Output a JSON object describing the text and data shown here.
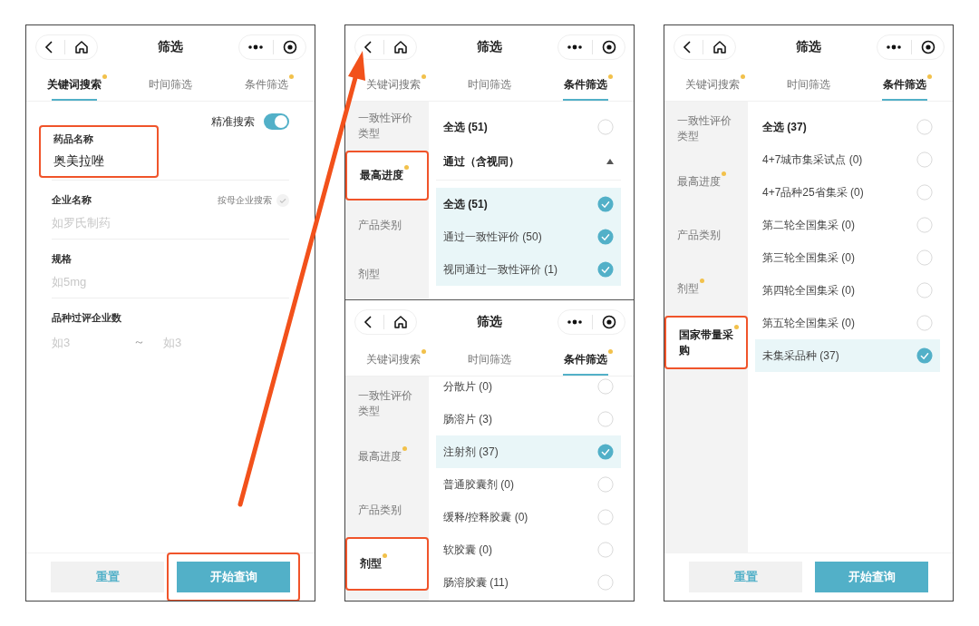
{
  "panels": [
    {
      "screens": [
        {
          "kind": "keyword",
          "title": "筛选",
          "tabs": [
            {
              "label": "关键词搜索",
              "selected": true,
              "dot": true
            },
            {
              "label": "时间筛选",
              "selected": false,
              "dot": false
            },
            {
              "label": "条件筛选",
              "selected": false,
              "dot": true
            }
          ],
          "precise_search": {
            "label": "精准搜索",
            "on": true
          },
          "fields": [
            {
              "label": "药品名称",
              "value": "奥美拉唑",
              "highlighted": true
            },
            {
              "label": "企业名称",
              "placeholder": "如罗氏制药",
              "option": {
                "label": "按母企业搜索",
                "checked": false
              }
            },
            {
              "label": "规格",
              "placeholder": "如5mg"
            }
          ],
          "range_field": {
            "label": "品种过评企业数",
            "min_placeholder": "如3",
            "separator": "～",
            "max_placeholder": "如3"
          },
          "buttons": [
            {
              "label": "重置",
              "kind": "secondary",
              "highlighted": false
            },
            {
              "label": "开始查询",
              "kind": "primary",
              "highlighted": true
            }
          ]
        }
      ]
    },
    {
      "screens": [
        {
          "kind": "condition",
          "title": "筛选",
          "tabs": [
            {
              "label": "关键词搜索",
              "selected": false,
              "dot": true
            },
            {
              "label": "时间筛选",
              "selected": false,
              "dot": false
            },
            {
              "label": "条件筛选",
              "selected": true,
              "dot": true
            }
          ],
          "sidebar": [
            {
              "label": "一致性评价类型",
              "selected": false,
              "dot": false,
              "highlighted": false
            },
            {
              "label": "最高进度",
              "selected": true,
              "dot": true,
              "highlighted": true
            },
            {
              "label": "产品类别",
              "selected": false,
              "dot": false,
              "highlighted": false
            },
            {
              "label": "剂型",
              "selected": false,
              "dot": false,
              "highlighted": false
            }
          ],
          "options": [
            {
              "kind": "select_all",
              "label": "全选 (51)",
              "checked": false
            },
            {
              "kind": "group",
              "label": "通过（含视同）",
              "expanded": true,
              "children": [
                {
                  "kind": "select_all",
                  "label": "全选 (51)",
                  "checked": true
                },
                {
                  "kind": "option",
                  "label": "通过一致性评价 (50)",
                  "checked": true
                },
                {
                  "kind": "option",
                  "label": "视同通过一致性评价 (1)",
                  "checked": true
                }
              ]
            }
          ]
        },
        {
          "kind": "condition",
          "title": "筛选",
          "tabs": [
            {
              "label": "关键词搜索",
              "selected": false,
              "dot": true
            },
            {
              "label": "时间筛选",
              "selected": false,
              "dot": false
            },
            {
              "label": "条件筛选",
              "selected": true,
              "dot": true
            }
          ],
          "sidebar": [
            {
              "label": "一致性评价类型",
              "selected": false,
              "dot": false,
              "highlighted": false
            },
            {
              "label": "最高进度",
              "selected": false,
              "dot": true,
              "highlighted": false
            },
            {
              "label": "产品类别",
              "selected": false,
              "dot": false,
              "highlighted": false
            },
            {
              "label": "剂型",
              "selected": true,
              "dot": true,
              "highlighted": true
            }
          ],
          "options": [
            {
              "kind": "option",
              "label": "分散片 (0)",
              "checked": false
            },
            {
              "kind": "option",
              "label": "肠溶片 (3)",
              "checked": false
            },
            {
              "kind": "option",
              "label": "注射剂 (37)",
              "checked": true
            },
            {
              "kind": "option",
              "label": "普通胶囊剂 (0)",
              "checked": false
            },
            {
              "kind": "option",
              "label": "缓释/控释胶囊 (0)",
              "checked": false
            },
            {
              "kind": "option",
              "label": "软胶囊 (0)",
              "checked": false
            },
            {
              "kind": "option",
              "label": "肠溶胶囊 (11)",
              "checked": false
            }
          ]
        }
      ]
    },
    {
      "screens": [
        {
          "kind": "condition",
          "title": "筛选",
          "tabs": [
            {
              "label": "关键词搜索",
              "selected": false,
              "dot": true
            },
            {
              "label": "时间筛选",
              "selected": false,
              "dot": false
            },
            {
              "label": "条件筛选",
              "selected": true,
              "dot": true
            }
          ],
          "sidebar": [
            {
              "label": "一致性评价类型",
              "selected": false,
              "dot": false,
              "highlighted": false
            },
            {
              "label": "最高进度",
              "selected": false,
              "dot": true,
              "highlighted": false
            },
            {
              "label": "产品类别",
              "selected": false,
              "dot": false,
              "highlighted": false
            },
            {
              "label": "剂型",
              "selected": false,
              "dot": true,
              "highlighted": false
            },
            {
              "label": "国家带量采购",
              "selected": true,
              "dot": true,
              "highlighted": true
            }
          ],
          "options": [
            {
              "kind": "select_all",
              "label": "全选 (37)",
              "checked": false
            },
            {
              "kind": "option",
              "label": "4+7城市集采试点 (0)",
              "checked": false
            },
            {
              "kind": "option",
              "label": "4+7品种25省集采 (0)",
              "checked": false
            },
            {
              "kind": "option",
              "label": "第二轮全国集采 (0)",
              "checked": false
            },
            {
              "kind": "option",
              "label": "第三轮全国集采 (0)",
              "checked": false
            },
            {
              "kind": "option",
              "label": "第四轮全国集采 (0)",
              "checked": false
            },
            {
              "kind": "option",
              "label": "第五轮全国集采 (0)",
              "checked": false
            },
            {
              "kind": "option",
              "label": "未集采品种 (37)",
              "checked": true
            }
          ],
          "buttons": [
            {
              "label": "重置",
              "kind": "secondary",
              "highlighted": false
            },
            {
              "label": "开始查询",
              "kind": "primary",
              "highlighted": false
            }
          ]
        }
      ]
    }
  ]
}
